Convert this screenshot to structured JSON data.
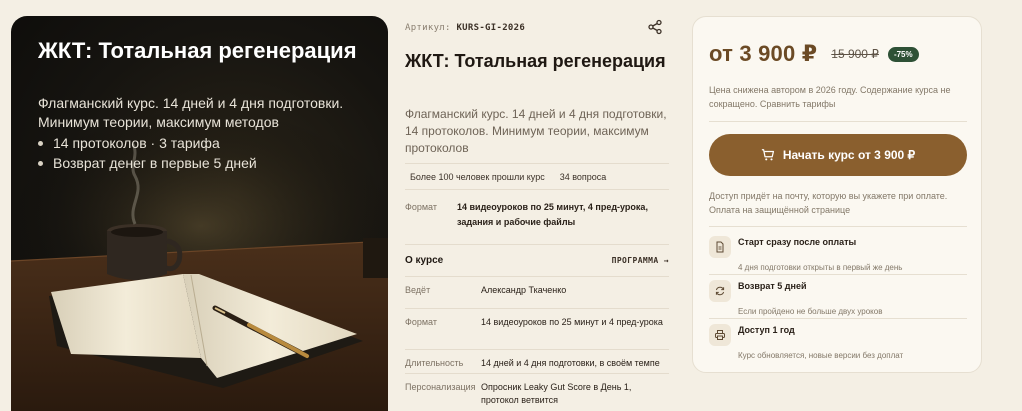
{
  "hero": {
    "title": "ЖКТ: Тотальная регенерация",
    "subtitle": "Флагманский курс. 14 дней и 4 дня подготовки. Минимум теории, максимум методов",
    "bullets": [
      "14 протоколов · 3 тарифа",
      "Возврат денег в первые 5 дней"
    ]
  },
  "product": {
    "sku_label": "Артикул:",
    "sku_value": "KURS-GI-2026",
    "title": "ЖКТ: Тотальная регенерация",
    "description": "Флагманский курс. 14 дней и 4 дня подготовки, 14 протоколов. Минимум теории, максимум протоколов",
    "stats": [
      "Более 100 человек прошли курс",
      "34 вопроса"
    ],
    "format_label": "Формат",
    "format_value": "14 видеоуроков по 25 минут, 4 пред-урока, задания и рабочие файлы",
    "about_title": "О курсе",
    "program_link": "ПРОГРАММА →",
    "details": [
      {
        "key": "Ведёт",
        "value": "Александр Ткаченко"
      },
      {
        "key": "Формат",
        "value": "14 видеоуроков по 25 минут и 4 пред-урока"
      },
      {
        "key": "Длительность",
        "value": "14 дней и 4 дня подготовки, в своём темпе"
      },
      {
        "key": "Персонализация",
        "value": "Опросник Leaky Gut Score в День 1, протокол ветвится"
      }
    ]
  },
  "purchase": {
    "price": "от 3 900 ₽",
    "old_price": "15 900 ₽",
    "discount": "-75%",
    "price_note": "Цена снижена автором в 2026 году. Содержание курса не сокращено. Сравнить тарифы",
    "buy_label": "Начать курс от 3 900 ₽",
    "access_note": "Доступ придёт на почту, которую вы укажете при оплате. Оплата на защищённой странице",
    "features": [
      {
        "icon": "document-icon",
        "title": "Старт сразу после оплаты",
        "subtitle": "4 дня подготовки открыты в первый же день"
      },
      {
        "icon": "refresh-icon",
        "title": "Возврат 5 дней",
        "subtitle": "Если пройдено не больше двух уроков"
      },
      {
        "icon": "printer-icon",
        "title": "Доступ 1 год",
        "subtitle": "Курс обновляется, новые версии без доплат"
      }
    ]
  },
  "colors": {
    "accent": "#8a5f2e",
    "price": "#6b4a25",
    "discount_badge": "#2e5136",
    "background": "#f4efe4"
  }
}
